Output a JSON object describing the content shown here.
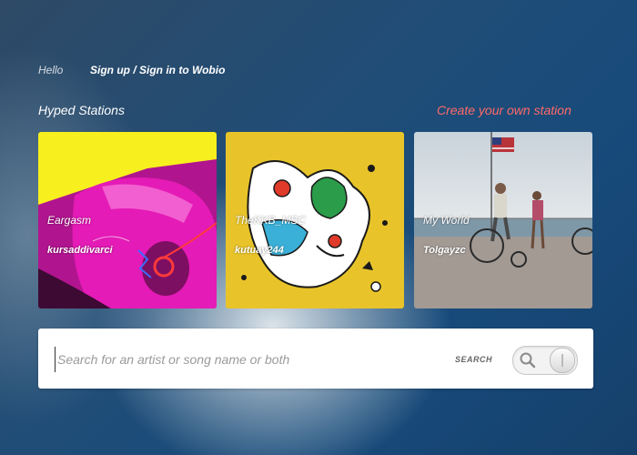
{
  "header": {
    "greeting": "Hello",
    "signin_label": "Sign up / Sign in to Wobio"
  },
  "section": {
    "title": "Hyped Stations",
    "create_label": "Create your own station",
    "create_color": "#ff6a6a"
  },
  "stations": [
    {
      "title": "Eargasm",
      "user": "kursaddivarci"
    },
    {
      "title": "TheKKB_MSC",
      "user": "kutuay244"
    },
    {
      "title": "My World",
      "user": "Tolgayzc"
    }
  ],
  "search": {
    "placeholder": "Search for an artist or song name or both",
    "button_label": "SEARCH",
    "icon": "search-icon"
  }
}
